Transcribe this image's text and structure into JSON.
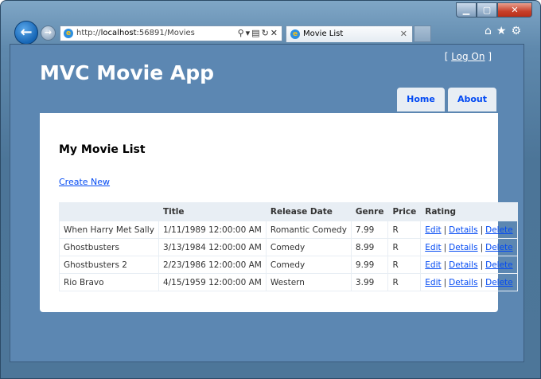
{
  "browser": {
    "url_prefix": "http://",
    "url_host": "localhost",
    "url_rest": ":56891/Movies",
    "tab_title": "Movie List"
  },
  "page": {
    "log_on": "Log On",
    "app_title": "MVC Movie App",
    "menu": {
      "home": "Home",
      "about": "About"
    },
    "heading": "My Movie List",
    "create_new": "Create New"
  },
  "table": {
    "headers": [
      "",
      "Title",
      "Release Date",
      "Genre",
      "Price",
      "Rating"
    ],
    "rows": [
      {
        "title": "When Harry Met Sally",
        "release": "1/11/1989 12:00:00 AM",
        "genre": "Romantic Comedy",
        "price": "7.99",
        "rating": "R"
      },
      {
        "title": "Ghostbusters",
        "release": "3/13/1984 12:00:00 AM",
        "genre": "Comedy",
        "price": "8.99",
        "rating": "R"
      },
      {
        "title": "Ghostbusters 2",
        "release": "2/23/1986 12:00:00 AM",
        "genre": "Comedy",
        "price": "9.99",
        "rating": "R"
      },
      {
        "title": "Rio Bravo",
        "release": "4/15/1959 12:00:00 AM",
        "genre": "Western",
        "price": "3.99",
        "rating": "R"
      }
    ],
    "actions": {
      "edit": "Edit",
      "details": "Details",
      "delete": "Delete"
    }
  }
}
